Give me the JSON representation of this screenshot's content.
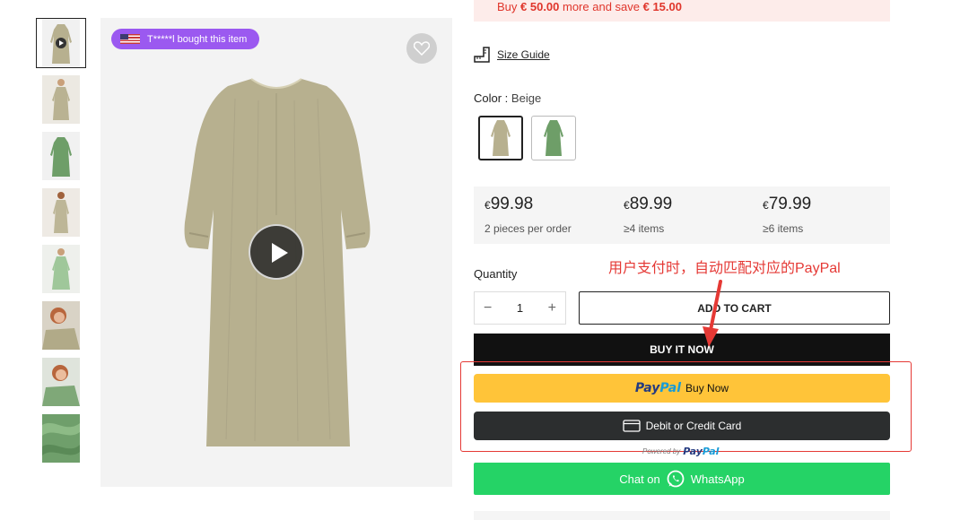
{
  "promo": {
    "prefix": "Buy ",
    "amount": "€ 50.00",
    "middle": " more and save ",
    "saving": "€ 15.00"
  },
  "badge": {
    "text": "T*****l bought this item"
  },
  "size_guide": {
    "label": "Size Guide"
  },
  "color": {
    "label": "Color :",
    "value": "Beige"
  },
  "tiers": [
    {
      "currency": "€",
      "price": "99.98",
      "qty": "2 pieces per order"
    },
    {
      "currency": "€",
      "price": "89.99",
      "qty": "≥4 items"
    },
    {
      "currency": "€",
      "price": "79.99",
      "qty": "≥6 items"
    }
  ],
  "quantity": {
    "label": "Quantity",
    "minus": "−",
    "value": "1",
    "plus": "+"
  },
  "annotation": "用户支付时，自动匹配对应的PayPal",
  "buttons": {
    "add_to_cart": "ADD TO CART",
    "buy_now": "BUY IT NOW",
    "paypal_logo_a": "Pay",
    "paypal_logo_b": "Pal",
    "paypal_text": "Buy Now",
    "card_text": "Debit or Credit Card",
    "powered_by": "Powered by",
    "whatsapp_prefix": "Chat on",
    "whatsapp_label": "WhatsApp"
  },
  "colors": {
    "beige": "#b7b08f",
    "green": "#6e9e68",
    "promo_red": "#e0362c",
    "badge_purple": "#9b59f0",
    "paypal_yellow": "#ffc439",
    "whatsapp_green": "#25d366"
  },
  "icons": [
    "play-icon",
    "heart-icon",
    "us-flag-icon",
    "ruler-icon",
    "card-icon",
    "whatsapp-icon",
    "arrow-annotation"
  ]
}
